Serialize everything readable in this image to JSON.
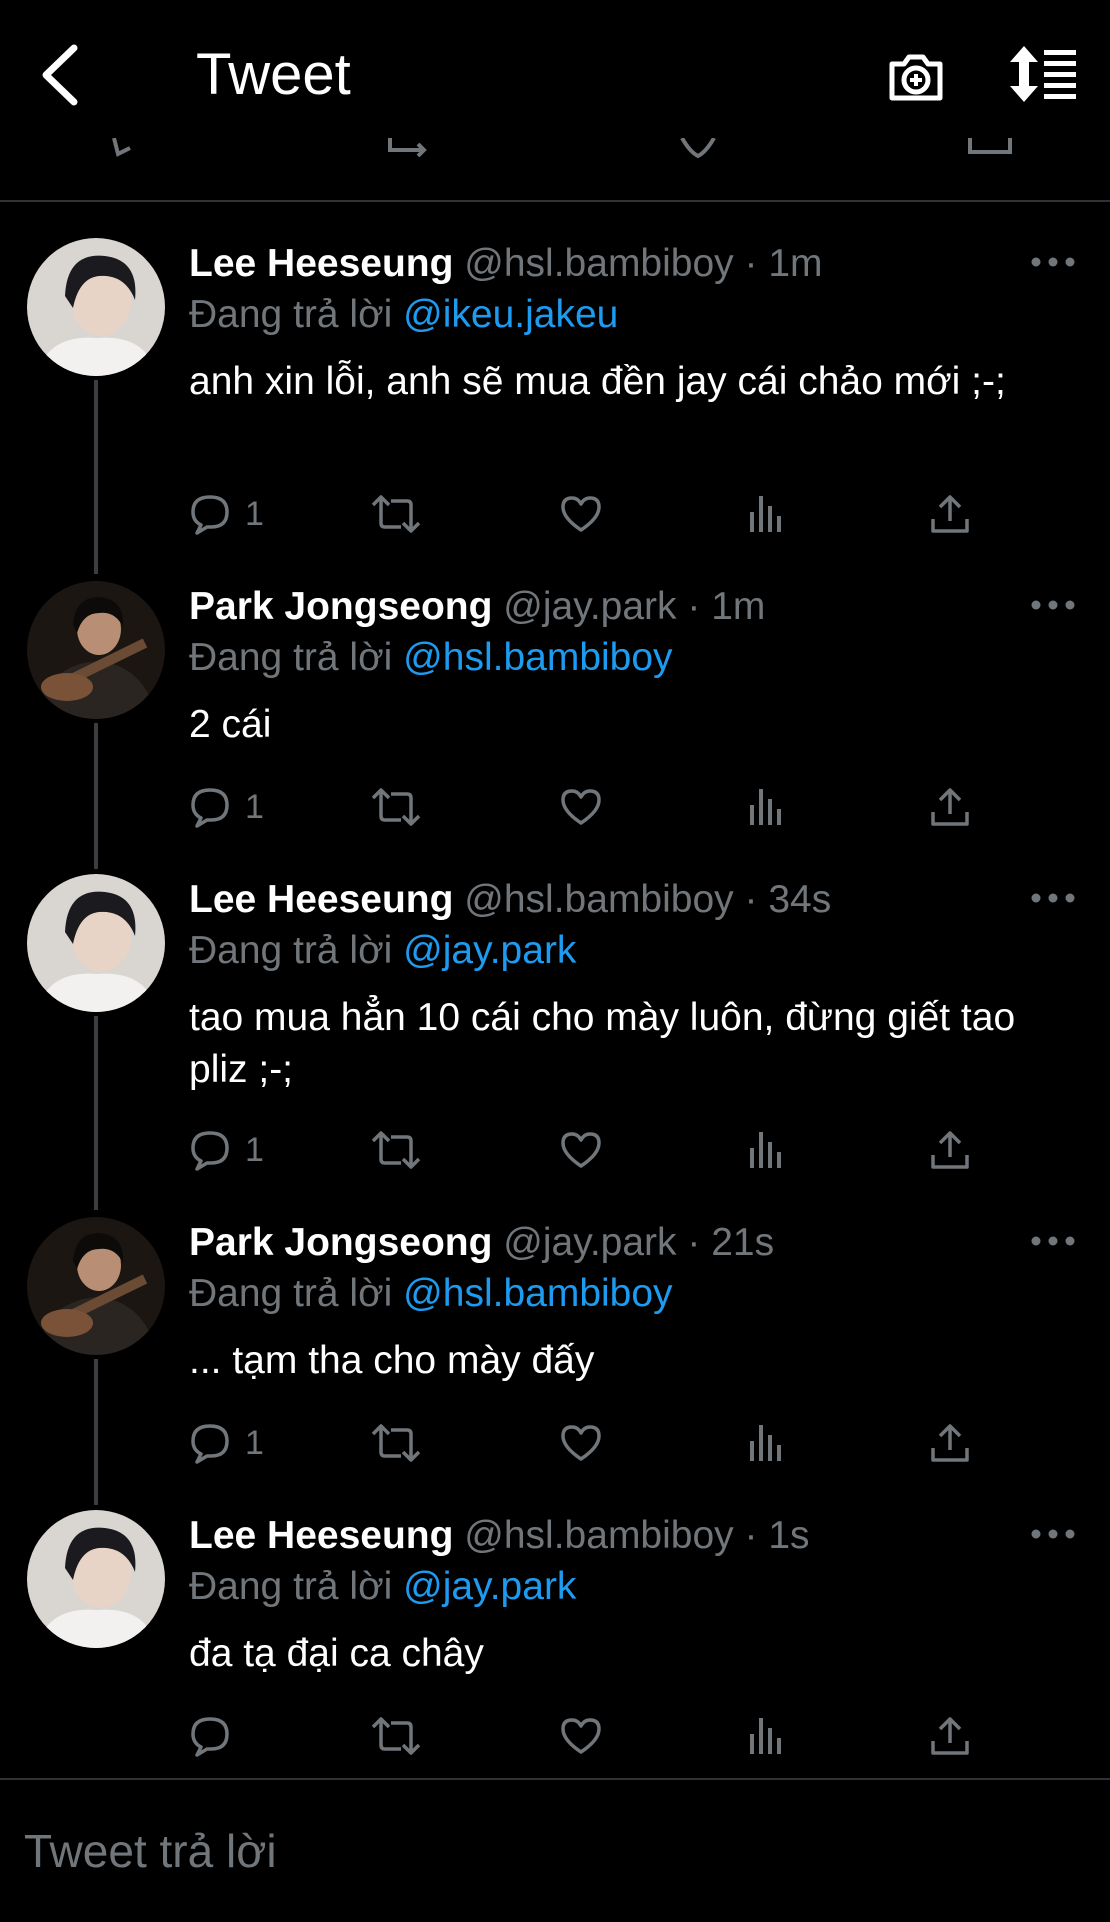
{
  "header": {
    "title": "Tweet",
    "back_icon": "chevron-left-icon",
    "camera_icon": "camera-plus-icon",
    "sort_icon": "sort-icon"
  },
  "colors": {
    "background": "#000000",
    "accent": "#1d9bf0",
    "muted": "#71767b",
    "text": "#ffffff",
    "divider": "#2f3336"
  },
  "replying_label": "Đang trả lời",
  "tweets": [
    {
      "name": "Lee Heeseung",
      "handle": "@hsl.bambiboy",
      "time": "· 1m",
      "replying_to": "@ikeu.jakeu",
      "text": "anh xin lỗi, anh sẽ mua đền jay cái chảo mới ;-;",
      "replies": "1"
    },
    {
      "name": "Park Jongseong",
      "handle": "@jay.park",
      "time": "· 1m",
      "replying_to": "@hsl.bambiboy",
      "text": "2 cái",
      "replies": "1"
    },
    {
      "name": "Lee Heeseung",
      "handle": "@hsl.bambiboy",
      "time": "· 34s",
      "replying_to": "@jay.park",
      "text": "tao mua hẳn 10 cái cho mày luôn, đừng giết tao pliz ;-;",
      "replies": "1"
    },
    {
      "name": "Park Jongseong",
      "handle": "@jay.park",
      "time": "· 21s",
      "replying_to": "@hsl.bambiboy",
      "text": "... tạm tha cho mày đấy",
      "replies": "1"
    },
    {
      "name": "Lee Heeseung",
      "handle": "@hsl.bambiboy",
      "time": "· 1s",
      "replying_to": "@jay.park",
      "text": "đa tạ đại ca chây",
      "replies": ""
    }
  ],
  "action_icons": [
    "reply-icon",
    "retweet-icon",
    "like-icon",
    "analytics-icon",
    "share-icon"
  ],
  "composer": {
    "placeholder": "Tweet trả lời"
  }
}
